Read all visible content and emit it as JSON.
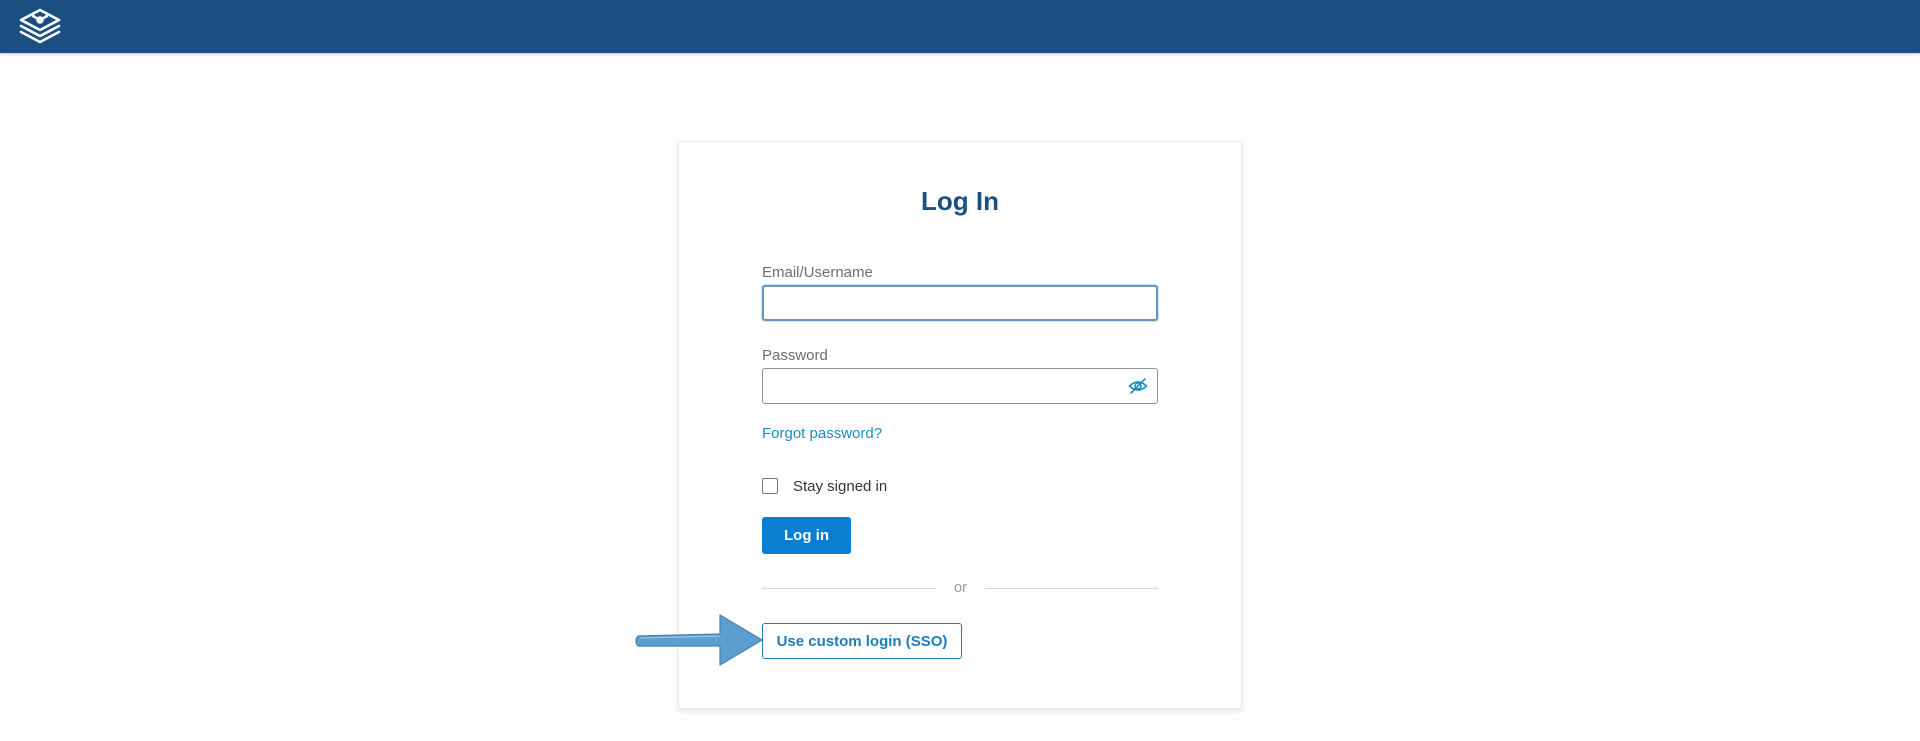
{
  "topbar": {
    "logo_icon": "layers-logo-icon",
    "color": "#1b4f82"
  },
  "login": {
    "title": "Log In",
    "email_label": "Email/Username",
    "email_value": "",
    "password_label": "Password",
    "password_value": "",
    "show_password_icon": "eye-slash-icon",
    "forgot_link": "Forgot password?",
    "stay_signed_in_label": "Stay signed in",
    "stay_signed_in_checked": false,
    "login_button": "Log in",
    "divider_text": "or",
    "sso_button": "Use custom login (SSO)"
  },
  "annotation": {
    "arrow_icon": "callout-arrow-icon",
    "arrow_color": "#5b9fd1"
  },
  "colors": {
    "primary": "#0a7fd1",
    "link": "#1a8dc0",
    "title": "#1b4f82"
  }
}
